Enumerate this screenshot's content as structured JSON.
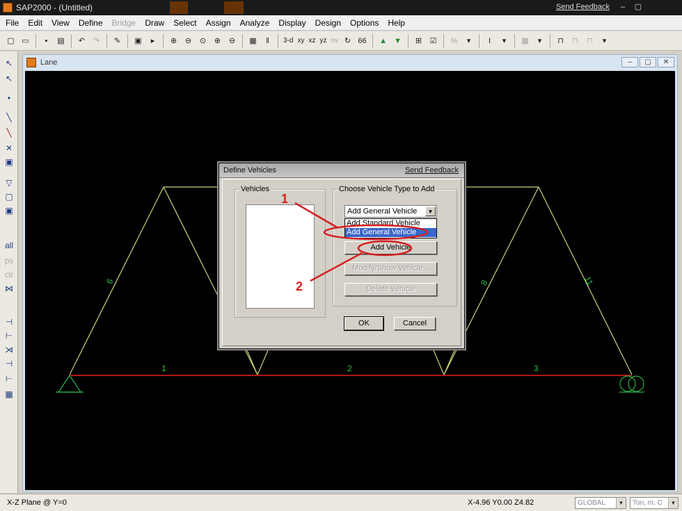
{
  "window": {
    "title": "SAP2000 - (Untitled)",
    "feedback": "Send Feedback",
    "btn_min": "–",
    "btn_max": "▢"
  },
  "menu": [
    {
      "label": "File",
      "name": "menu-file",
      "enabled": true
    },
    {
      "label": "Edit",
      "name": "menu-edit",
      "enabled": true
    },
    {
      "label": "View",
      "name": "menu-view",
      "enabled": true
    },
    {
      "label": "Define",
      "name": "menu-define",
      "enabled": true
    },
    {
      "label": "Bridge",
      "name": "menu-bridge",
      "enabled": false
    },
    {
      "label": "Draw",
      "name": "menu-draw",
      "enabled": true
    },
    {
      "label": "Select",
      "name": "menu-select",
      "enabled": true
    },
    {
      "label": "Assign",
      "name": "menu-assign",
      "enabled": true
    },
    {
      "label": "Analyze",
      "name": "menu-analyze",
      "enabled": true
    },
    {
      "label": "Display",
      "name": "menu-display",
      "enabled": true
    },
    {
      "label": "Design",
      "name": "menu-design",
      "enabled": true
    },
    {
      "label": "Options",
      "name": "menu-options",
      "enabled": true
    },
    {
      "label": "Help",
      "name": "menu-help",
      "enabled": true
    }
  ],
  "toolbar": {
    "view_3d": "3-d",
    "view_xy": "xy",
    "view_xz": "xz",
    "view_yz": "yz",
    "view_nv": "nv"
  },
  "mdi": {
    "title": "Lane"
  },
  "model": {
    "frame_labels": [
      "1",
      "2",
      "3",
      "6",
      "8",
      "11"
    ],
    "frame_color": "#c9d37a",
    "lane_color": "#b01818",
    "support_color": "#31b04a",
    "label_color": "#2fbf4a"
  },
  "dialog": {
    "title": "Define Vehicles",
    "feedback": "Send Feedback",
    "vehicles_group": "Vehicles",
    "choose_group": "Choose Vehicle Type to Add",
    "combo_value": "Add General Vehicle",
    "dropdown_options": [
      "Add Standard Vehicle",
      "Add General Vehicle"
    ],
    "add_button": "Add Vehicle",
    "modify_button": "Modify/Show Vehicle...",
    "delete_button": "Delete Vehicle",
    "ok_button": "OK",
    "cancel_button": "Cancel"
  },
  "annotations": {
    "step1": "1",
    "step2": "2",
    "color": "#d42020"
  },
  "status": {
    "plane": "X-Z Plane @ Y=0",
    "coords": "X-4.96  Y0.00  Z4.82",
    "coord_system": "GLOBAL",
    "units": "Ton, m, C"
  }
}
